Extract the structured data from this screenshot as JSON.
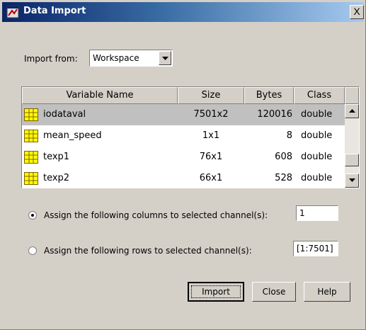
{
  "window": {
    "title": "Data Import",
    "close_glyph": "X",
    "title_icon": "matlab-figure-icon"
  },
  "import_from": {
    "label": "Import from:",
    "selected": "Workspace"
  },
  "table": {
    "columns": [
      "Variable Name",
      "Size",
      "Bytes",
      "Class"
    ],
    "rows": [
      {
        "name": "iodataval",
        "size": "7501x2",
        "bytes": "120016",
        "class": "double",
        "selected": true
      },
      {
        "name": "mean_speed",
        "size": "1x1",
        "bytes": "8",
        "class": "double",
        "selected": false
      },
      {
        "name": "texp1",
        "size": "76x1",
        "bytes": "608",
        "class": "double",
        "selected": false
      },
      {
        "name": "texp2",
        "size": "66x1",
        "bytes": "528",
        "class": "double",
        "selected": false
      }
    ]
  },
  "assign_columns": {
    "label": "Assign the following columns to selected channel(s):",
    "value": "1",
    "checked": true
  },
  "assign_rows": {
    "label": "Assign the following rows to selected channel(s):",
    "value": "[1:7501]",
    "checked": false
  },
  "buttons": {
    "import": "Import",
    "close": "Close",
    "help": "Help"
  },
  "colors": {
    "dialog_bg": "#d4d0c8",
    "title_start": "#0a246a",
    "title_end": "#a6caf0",
    "selected_row": "#c0c0c0",
    "variable_icon": "#ffff00"
  }
}
